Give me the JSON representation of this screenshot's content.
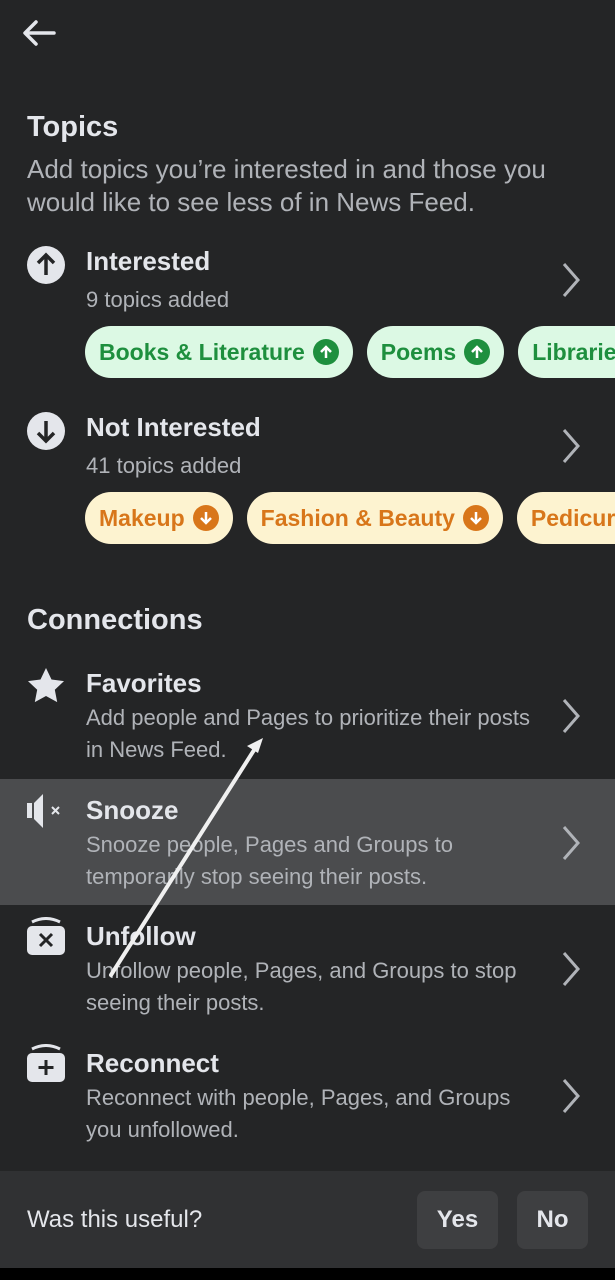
{
  "header": {
    "back_icon": "arrow-left-icon"
  },
  "topics": {
    "title": "Topics",
    "subtitle": "Add topics you’re interested in and those you would like to see less of in News Feed.",
    "interested": {
      "label": "Interested",
      "count": "9 topics added",
      "icon": "arrow-up-circle-icon",
      "chips": [
        "Books & Literature",
        "Poems",
        "Libraries"
      ],
      "chip_color": "#1e8f3e"
    },
    "not_interested": {
      "label": "Not Interested",
      "count": "41 topics added",
      "icon": "arrow-down-circle-icon",
      "chips": [
        "Makeup",
        "Fashion & Beauty",
        "Pedicure"
      ],
      "chip_color": "#d8761a"
    }
  },
  "connections": {
    "title": "Connections",
    "items": [
      {
        "label": "Favorites",
        "desc": "Add people and Pages to prioritize their posts in News Feed.",
        "icon": "star-icon"
      },
      {
        "label": "Snooze",
        "desc": "Snooze people, Pages and Groups to temporarily stop seeing their posts.",
        "icon": "muted-speaker-icon",
        "highlighted": true
      },
      {
        "label": "Unfollow",
        "desc": "Unfollow people, Pages, and Groups to stop seeing their posts.",
        "icon": "box-x-icon"
      },
      {
        "label": "Reconnect",
        "desc": "Reconnect with people, Pages, and Groups you unfollowed.",
        "icon": "box-plus-icon"
      }
    ]
  },
  "feedback": {
    "question": "Was this useful?",
    "yes": "Yes",
    "no": "No"
  }
}
